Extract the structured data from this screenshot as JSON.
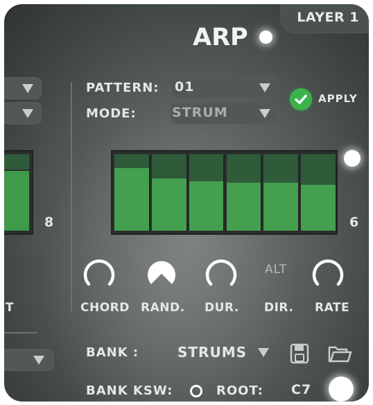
{
  "header": {
    "layer_label": "LAYER 1",
    "title": "ARP"
  },
  "controls": {
    "pattern_label": "PATTERN:",
    "pattern_value": "01",
    "mode_label": "MODE:",
    "mode_value": "STRUM",
    "apply_label": "APPLY"
  },
  "steps": {
    "left_value": "8",
    "right_value": "6",
    "levels": [
      0.82,
      0.68,
      0.65,
      0.63,
      0.63,
      0.6
    ]
  },
  "knobs": [
    {
      "label": "CHORD"
    },
    {
      "label": "RAND."
    },
    {
      "label": "DUR."
    },
    {
      "label": "DIR.",
      "value": "ALT"
    },
    {
      "label": "RATE"
    }
  ],
  "bank": {
    "bank_label": "BANK :",
    "bank_value": "STRUMS",
    "bank_ksw_label": "BANK KSW:",
    "root_label": "ROOT:",
    "root_value": "C7"
  },
  "left_panel": {
    "partial_label": "T"
  },
  "colors": {
    "accent_green": "#44a04f",
    "apply_green": "#3ab34a",
    "panel": "#5b6260"
  }
}
